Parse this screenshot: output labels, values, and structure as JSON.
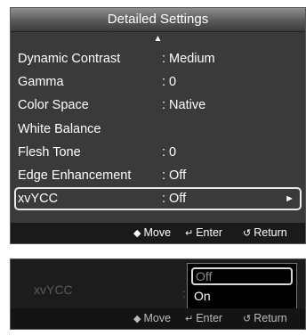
{
  "settings_panel": {
    "title": "Detailed Settings",
    "scroll_up_glyph": "▲",
    "rows": [
      {
        "label": "Dynamic Contrast",
        "value": ": Medium"
      },
      {
        "label": "Gamma",
        "value": ": 0"
      },
      {
        "label": "Color Space",
        "value": ": Native"
      },
      {
        "label": "White Balance",
        "value": ""
      },
      {
        "label": "Flesh Tone",
        "value": ": 0"
      },
      {
        "label": "Edge Enhancement",
        "value": ": Off"
      },
      {
        "label": "xvYCC",
        "value": ": Off",
        "arrow": "►"
      }
    ],
    "help": {
      "move_icon": "◆",
      "move": "Move",
      "enter_icon": "↵",
      "enter": "Enter",
      "return_icon": "↺",
      "return": "Return"
    }
  },
  "option_panel": {
    "label": "xvYCC",
    "colon": ":",
    "options": [
      {
        "label": "Off",
        "state": "disabled-highlighted"
      },
      {
        "label": "On",
        "state": "normal"
      }
    ],
    "help": {
      "move_icon": "◆",
      "move": "Move",
      "enter_icon": "↵",
      "enter": "Enter",
      "return_icon": "↺",
      "return": "Return"
    }
  }
}
